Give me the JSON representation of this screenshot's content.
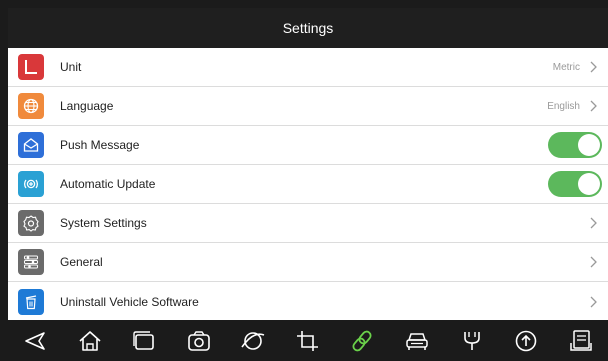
{
  "header": {
    "title": "Settings"
  },
  "settings": {
    "items": [
      {
        "label": "Unit",
        "value": "Metric",
        "icon": "unit-icon",
        "color": "#d9383a"
      },
      {
        "label": "Language",
        "value": "English",
        "icon": "globe-icon",
        "color": "#f08a3c"
      },
      {
        "label": "Push Message",
        "toggle": true,
        "icon": "envelope-icon",
        "color": "#2e6fd8"
      },
      {
        "label": "Automatic Update",
        "toggle": true,
        "icon": "update-icon",
        "color": "#2aa1d4"
      },
      {
        "label": "System Settings",
        "icon": "gear-icon",
        "color": "#6b6b6b"
      },
      {
        "label": "General",
        "icon": "sliders-icon",
        "color": "#6b6b6b"
      },
      {
        "label": "Uninstall Vehicle Software",
        "icon": "trash-icon",
        "color": "#1e7ad6"
      }
    ]
  },
  "colors": {
    "accent": "#5cb85c",
    "titlebar": "#1f1f1f",
    "navbar": "#1b1b1b",
    "active_nav": "#6ad14a"
  },
  "navbar": {
    "buttons": [
      "back-icon",
      "home-icon",
      "recent-apps-icon",
      "camera-icon",
      "browser-icon",
      "crop-icon",
      "link-icon",
      "car-icon",
      "vci-icon",
      "upload-icon",
      "report-icon"
    ]
  }
}
